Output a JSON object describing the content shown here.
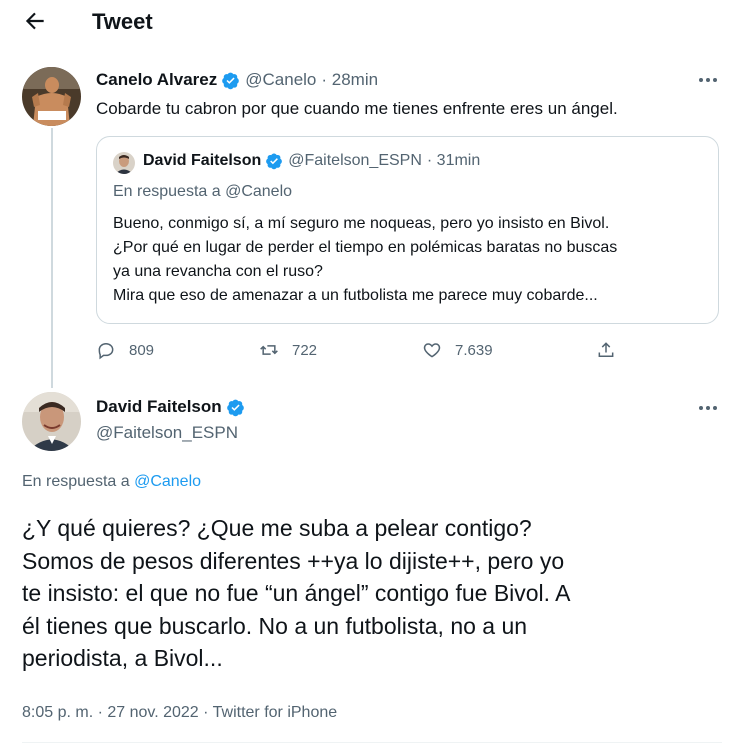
{
  "header": {
    "title": "Tweet",
    "back_icon": "arrow-left-icon"
  },
  "colors": {
    "accent": "#1d9bf0",
    "muted": "#536471",
    "text": "#0f1419",
    "border": "#cfd9de"
  },
  "parent_tweet": {
    "author_name": "Canelo Alvarez",
    "handle": "@Canelo",
    "time": "· 28min",
    "verified_icon": "verified-badge-icon",
    "text": "Cobarde tu cabron por que cuando me tienes enfrente eres un ángel.",
    "quote": {
      "author_name": "David Faitelson",
      "handle": "@Faitelson_ESPN",
      "time": "· 31min",
      "reply_to": "En respuesta a @Canelo",
      "lines": [
        "Bueno, conmigo sí, a mí seguro me noqueas, pero yo insisto en Bivol.",
        "¿Por qué en lugar de perder el tiempo en polémicas baratas no buscas",
        "ya una revancha con el ruso?",
        "Mira que eso de amenazar a un futbolista me parece muy cobarde..."
      ]
    },
    "actions": {
      "replies": "809",
      "retweets": "722",
      "likes": "7.639"
    }
  },
  "main_tweet": {
    "author_name": "David Faitelson",
    "handle": "@Faitelson_ESPN",
    "reply_prefix": "En respuesta a",
    "reply_mention": "@Canelo",
    "text_lines": [
      "¿Y qué quieres? ¿Que me suba a pelear contigo?",
      "Somos de pesos diferentes ++ya lo dijiste++, pero yo",
      "te insisto: el que no fue “un ángel” contigo fue Bivol. A",
      "él tienes que buscarlo. No a un futbolista, no a un",
      "periodista, a Bivol..."
    ],
    "timestamp": "8:05 p. m. · 27 nov. 2022 · Twitter for iPhone"
  }
}
